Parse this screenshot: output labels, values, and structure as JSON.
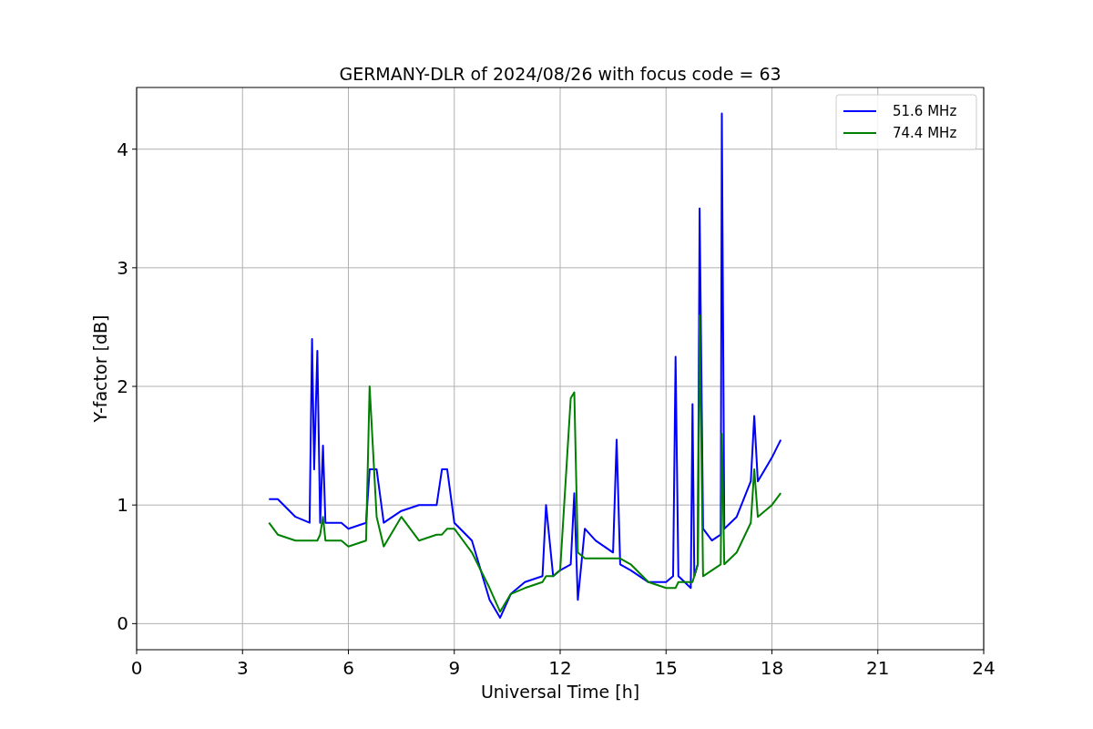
{
  "figure": {
    "chart_data": {
      "type": "line",
      "title": "GERMANY-DLR of 2024/08/26 with focus code = 63",
      "xlabel": "Universal Time [h]",
      "ylabel": "Y-factor [dB]",
      "x": [
        3.75,
        4,
        4.5,
        4.9,
        4.97,
        5.03,
        5.12,
        5.2,
        5.28,
        5.35,
        5.8,
        6,
        6.5,
        6.6,
        6.8,
        7,
        7.5,
        8,
        8.5,
        8.65,
        8.8,
        9,
        9.5,
        10,
        10.3,
        10.6,
        11,
        11.5,
        11.6,
        11.8,
        12,
        12.3,
        12.4,
        12.5,
        12.7,
        13,
        13.5,
        13.6,
        13.7,
        14,
        14.5,
        15,
        15.2,
        15.27,
        15.35,
        15.7,
        15.75,
        15.8,
        15.9,
        15.95,
        16.05,
        16.3,
        16.55,
        16.58,
        16.65,
        17,
        17.4,
        17.5,
        17.6,
        18,
        18.25
      ],
      "series": [
        {
          "name": "51.6 MHz",
          "color": "#0000ff",
          "values": [
            1.05,
            1.05,
            0.9,
            0.85,
            2.4,
            1.3,
            2.3,
            0.85,
            1.5,
            0.85,
            0.85,
            0.8,
            0.85,
            1.3,
            1.3,
            0.85,
            0.95,
            1.0,
            1.0,
            1.3,
            1.3,
            0.85,
            0.7,
            0.2,
            0.05,
            0.25,
            0.35,
            0.4,
            1.0,
            0.4,
            0.45,
            0.5,
            1.1,
            0.2,
            0.8,
            0.7,
            0.6,
            1.55,
            0.5,
            0.45,
            0.35,
            0.35,
            0.4,
            2.25,
            0.4,
            0.3,
            1.85,
            0.4,
            0.5,
            3.5,
            0.8,
            0.7,
            0.75,
            4.3,
            0.8,
            0.9,
            1.2,
            1.75,
            1.2,
            1.4,
            1.55
          ]
        },
        {
          "name": "74.4 MHz",
          "color": "#008000",
          "values": [
            0.85,
            0.75,
            0.7,
            0.7,
            0.7,
            0.7,
            0.7,
            0.75,
            0.9,
            0.7,
            0.7,
            0.65,
            0.7,
            2.0,
            0.9,
            0.65,
            0.9,
            0.7,
            0.75,
            0.75,
            0.8,
            0.8,
            0.6,
            0.3,
            0.1,
            0.25,
            0.3,
            0.35,
            0.4,
            0.4,
            0.45,
            1.9,
            1.95,
            0.6,
            0.55,
            0.55,
            0.55,
            0.55,
            0.55,
            0.5,
            0.35,
            0.3,
            0.3,
            0.3,
            0.35,
            0.35,
            0.35,
            0.4,
            0.5,
            2.6,
            0.4,
            0.45,
            0.5,
            1.6,
            0.5,
            0.6,
            0.85,
            1.3,
            0.9,
            1.0,
            1.1
          ]
        }
      ],
      "grid": true,
      "legend": true,
      "xlim": [
        0,
        24
      ],
      "ylim": [
        -0.22,
        4.52
      ],
      "xticks": [
        0,
        3,
        6,
        9,
        12,
        15,
        18,
        21,
        24
      ],
      "yticks": [
        0,
        1,
        2,
        3,
        4
      ]
    }
  }
}
